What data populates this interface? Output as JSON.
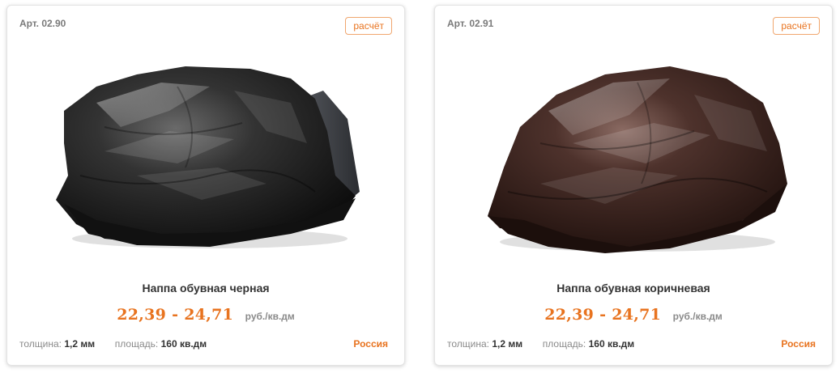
{
  "products": [
    {
      "article": "Арт. 02.90",
      "calc_label": "расчёт",
      "name": "Наппа обувная черная",
      "price": "22,39 - 24,71",
      "unit": "руб./кв.дм",
      "thickness_label": "толщина:",
      "thickness_value": "1,2 мм",
      "area_label": "площадь:",
      "area_value": "160 кв.дм",
      "country": "Россия",
      "leather_color": "#2a2a2a"
    },
    {
      "article": "Арт. 02.91",
      "calc_label": "расчёт",
      "name": "Наппа обувная коричневая",
      "price": "22,39 - 24,71",
      "unit": "руб./кв.дм",
      "thickness_label": "толщина:",
      "thickness_value": "1,2 мм",
      "area_label": "площадь:",
      "area_value": "160 кв.дм",
      "country": "Россия",
      "leather_color": "#3b2520"
    }
  ],
  "colors": {
    "accent": "#e8731f",
    "muted_text": "#8a8a8a",
    "dark_text": "#333333"
  }
}
